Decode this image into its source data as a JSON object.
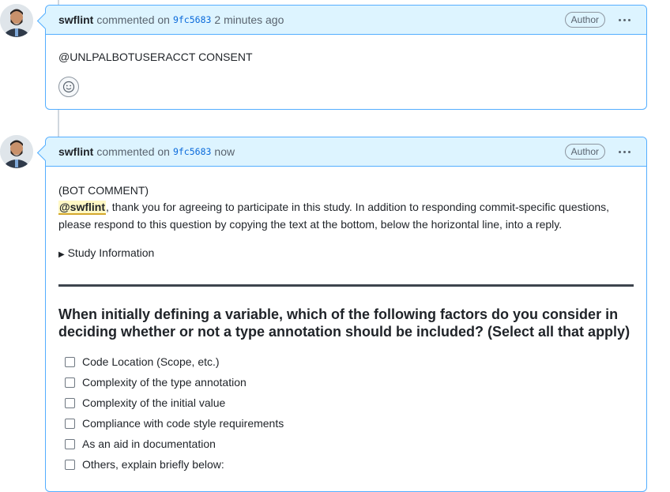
{
  "comments": [
    {
      "author": "swflint",
      "action": "commented on",
      "sha": "9fc5683",
      "time": "2 minutes ago",
      "badge": "Author",
      "body": "@UNLPALBOTUSERACCT CONSENT"
    },
    {
      "author": "swflint",
      "action": "commented on",
      "sha": "9fc5683",
      "time": "now",
      "badge": "Author",
      "bot_label": "(BOT COMMENT)",
      "mention": "@swflint",
      "intro": ", thank you for agreeing to participate in this study. In addition to responding commit-specific questions, please respond to this question by copying the text at the bottom, below the horizontal line, into a reply.",
      "details_summary": "Study Information",
      "question": "When initially defining a variable, which of the following factors do you consider in deciding whether or not a type annotation should be included? (Select all that apply)",
      "options": [
        "Code Location (Scope, etc.)",
        "Complexity of the type annotation",
        "Complexity of the initial value",
        "Compliance with code style requirements",
        "As an aid in documentation",
        "Others, explain briefly below:"
      ]
    }
  ],
  "icons": {
    "reaction": "smiley-icon",
    "menu": "kebab-horizontal-icon",
    "details_marker": "triangle-right-icon"
  },
  "colors": {
    "header_bg": "#ddf4ff",
    "border": "#54aeff",
    "mention_bg": "#fff8c5",
    "link": "#0969da"
  }
}
